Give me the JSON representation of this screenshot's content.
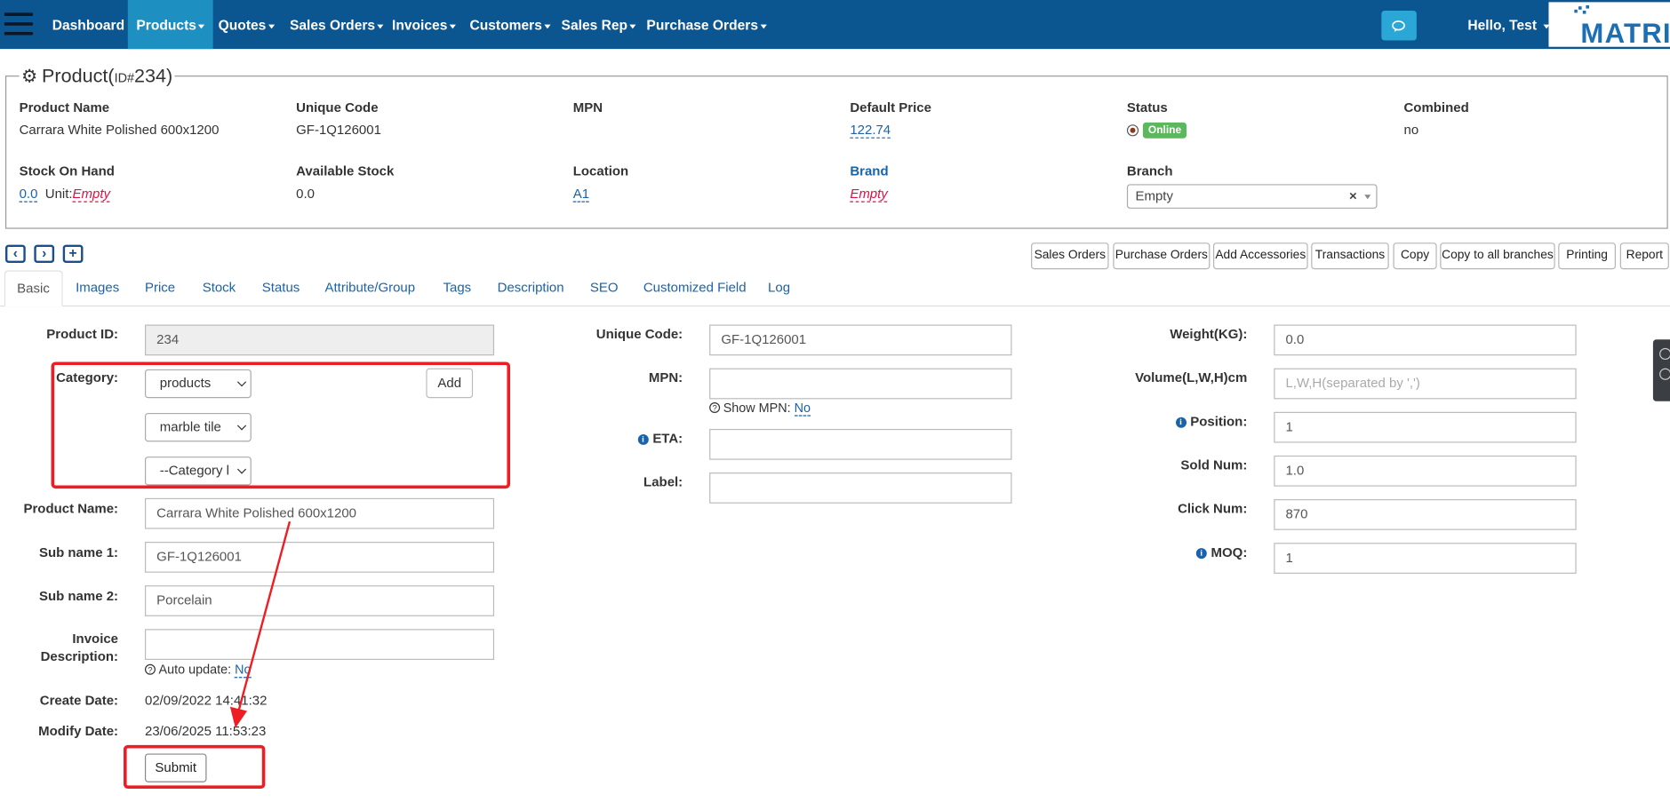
{
  "nav": {
    "items": [
      {
        "label": "Dashboard",
        "dropdown": false,
        "active": false
      },
      {
        "label": "Products",
        "dropdown": true,
        "active": true
      },
      {
        "label": "Quotes",
        "dropdown": true,
        "active": false
      },
      {
        "label": "Sales Orders",
        "dropdown": true,
        "active": false
      },
      {
        "label": "Invoices",
        "dropdown": true,
        "active": false
      },
      {
        "label": "Customers",
        "dropdown": true,
        "active": false
      },
      {
        "label": "Sales Rep",
        "dropdown": true,
        "active": false
      },
      {
        "label": "Purchase Orders",
        "dropdown": true,
        "active": false
      }
    ],
    "greeting": "Hello, Test",
    "logo_text": "MATRICL",
    "colors": {
      "navbar": "#0b5590",
      "active": "#1d8fc0",
      "chat": "#2aa7d6"
    }
  },
  "product": {
    "title": "Product",
    "id_prefix": "ID#",
    "id": "234",
    "fields": {
      "product_name_label": "Product Name",
      "product_name": "Carrara White Polished 600x1200",
      "unique_code_label": "Unique Code",
      "unique_code": "GF-1Q126001",
      "mpn_label": "MPN",
      "default_price_label": "Default Price",
      "default_price": "122.74",
      "status_label": "Status",
      "status_badge": "Online",
      "combined_label": "Combined",
      "combined": "no",
      "stock_on_hand_label": "Stock On Hand",
      "stock_on_hand": "0.0",
      "unit_label": "Unit:",
      "unit_value": "Empty",
      "available_stock_label": "Available Stock",
      "available_stock": "0.0",
      "location_label": "Location",
      "location": "A1",
      "brand_label": "Brand",
      "brand_value": "Empty",
      "branch_label": "Branch",
      "branch_value": "Empty"
    }
  },
  "toolbar": {
    "buttons": [
      "Sales Orders",
      "Purchase Orders",
      "Add Accessories",
      "Transactions",
      "Copy",
      "Copy to all branches",
      "Printing",
      "Report"
    ]
  },
  "tabs": [
    "Basic",
    "Images",
    "Price",
    "Stock",
    "Status",
    "Attribute/Group",
    "Tags",
    "Description",
    "SEO",
    "Customized Field",
    "Log"
  ],
  "form": {
    "product_id_label": "Product ID:",
    "product_id": "234",
    "category_label": "Category:",
    "category_1": "products",
    "category_2": "marble tile",
    "category_3": "--Category l",
    "add_label": "Add",
    "product_name_label": "Product Name:",
    "product_name": "Carrara White Polished 600x1200",
    "sub_name1_label": "Sub name 1:",
    "sub_name1": "GF-1Q126001",
    "sub_name2_label": "Sub name 2:",
    "sub_name2": "Porcelain",
    "invoice_desc_label_1": "Invoice",
    "invoice_desc_label_2": "Description:",
    "invoice_desc": "",
    "auto_update_label": "Auto update:",
    "auto_update_value": "No",
    "create_date_label": "Create Date:",
    "create_date": "02/09/2022 14:41:32",
    "modify_date_label": "Modify Date:",
    "modify_date": "23/06/2025 11:53:23",
    "submit_label": "Submit",
    "unique_code_label": "Unique Code:",
    "unique_code": "GF-1Q126001",
    "mpn_label": "MPN:",
    "mpn": "",
    "show_mpn_label": "Show MPN:",
    "show_mpn_value": "No",
    "eta_label": "ETA:",
    "eta": "",
    "label_label": "Label:",
    "label": "",
    "weight_label": "Weight(KG):",
    "weight": "0.0",
    "volume_label": "Volume(L,W,H)cm",
    "volume_placeholder": "L,W,H(separated by ',')",
    "position_label": "Position:",
    "position": "1",
    "sold_num_label": "Sold Num:",
    "sold_num": "1.0",
    "click_num_label": "Click Num:",
    "click_num": "870",
    "moq_label": "MOQ:",
    "moq": "1"
  },
  "annotation_color": "#ee1d24"
}
